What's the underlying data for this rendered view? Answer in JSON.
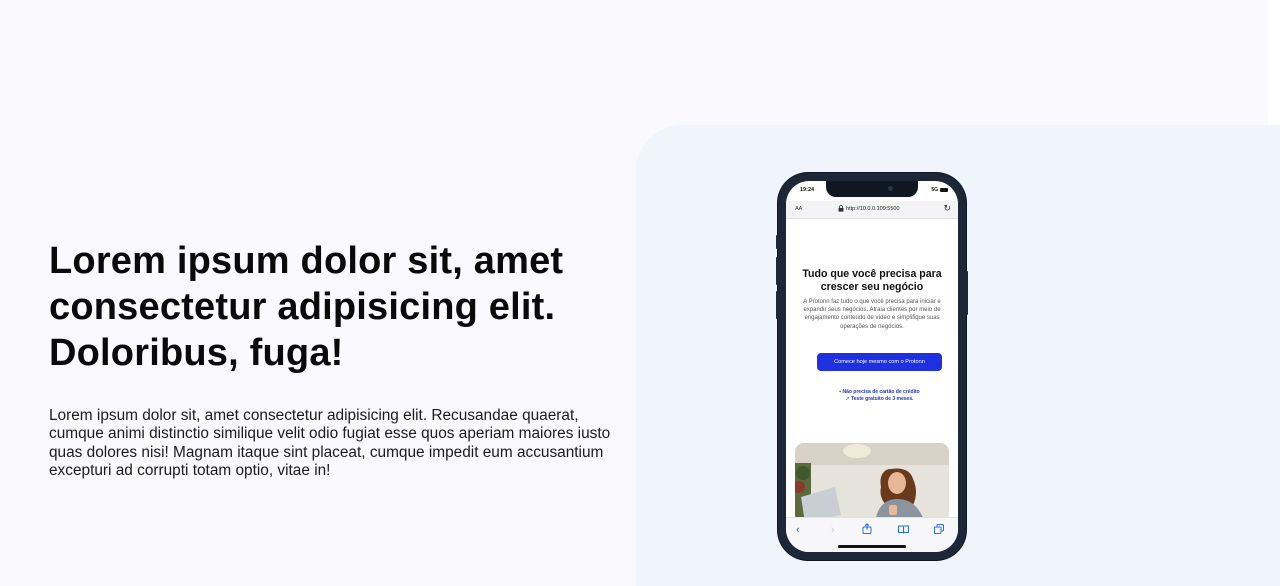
{
  "hero": {
    "headline": "Lorem ipsum dolor sit, amet consectetur adipisicing elit. Doloribus, fuga!",
    "lead": "Lorem ipsum dolor sit, amet consectetur adipisicing elit. Recusandae quaerat, cumque animi distinctio similique velit odio fugiat esse quos aperiam maiores iusto quas dolores nisi! Magnam itaque sint placeat, cumque impedit eum accusantium excepturi ad corrupti totam optio, vitae in!"
  },
  "phone": {
    "status_time": "19:24",
    "status_right": "5G",
    "url_aa": "AA",
    "url": "http://10.0.0.109:5500",
    "title": "Tudo que você precisa para crescer seu negócio",
    "description": "A Protonn faz tudo o que você precisa para iniciar e expandir seus negócios. Atraia clientes por meio de engajamento conteúdo de vídeo e simplifique suas operações de negócios.",
    "cta": "Comece hoje mesmo com o Protonn",
    "note_1": "Não precisa de cartão de crédito",
    "note_2": "Teste gratuito de 3 meses."
  },
  "colors": {
    "page_bg": "#f9f9fe",
    "panel_bg": "#eff4fd",
    "cta_bg": "#1f30de",
    "phone_frame": "#1c2838"
  },
  "icons": {
    "lock": "lock-icon",
    "reload": "reload-icon",
    "back": "back-icon",
    "forward": "forward-icon",
    "share": "share-icon",
    "bookmarks": "book-icon",
    "tabs": "tabs-icon"
  }
}
